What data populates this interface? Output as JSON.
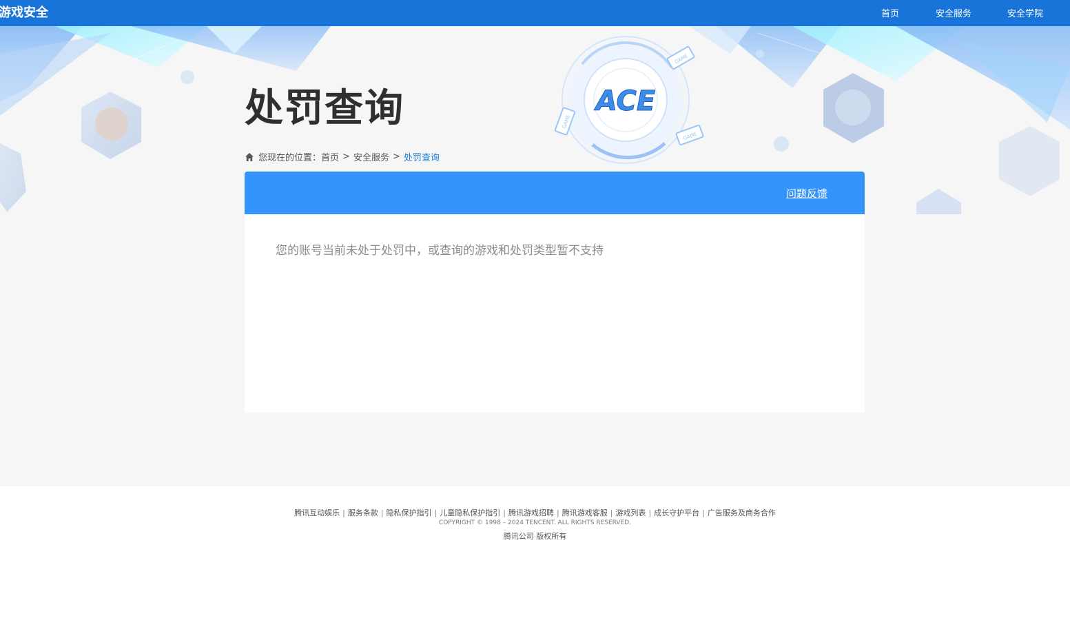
{
  "header": {
    "logo_text": "游戏安全",
    "nav": [
      {
        "label": "首页"
      },
      {
        "label": "安全服务"
      },
      {
        "label": "安全学院"
      }
    ]
  },
  "hero": {
    "title": "处罚查询",
    "emblem_text": "ACE",
    "badge_text": "GAME"
  },
  "breadcrumb": {
    "prefix": "您现在的位置：",
    "items": [
      "首页",
      "安全服务",
      "处罚查询"
    ],
    "separator": ">"
  },
  "panel": {
    "feedback_label": "问题反馈",
    "message": "您的账号当前未处于处罚中，或查询的游戏和处罚类型暂不支持"
  },
  "footer": {
    "links": [
      "腾讯互动娱乐",
      "服务条款",
      "隐私保护指引",
      "儿童隐私保护指引",
      "腾讯游戏招聘",
      "腾讯游戏客服",
      "游戏列表",
      "成长守护平台",
      "广告服务及商务合作"
    ],
    "separator": "|",
    "copyright": "COPYRIGHT © 1998 – 2024 TENCENT. ALL RIGHTS RESERVED.",
    "company": "腾讯公司 版权所有"
  },
  "colors": {
    "topbar": "#1874d8",
    "panel_header": "#3395fc",
    "breadcrumb_current": "#1e7fd6",
    "hero_bg": "#f6f6f7"
  }
}
